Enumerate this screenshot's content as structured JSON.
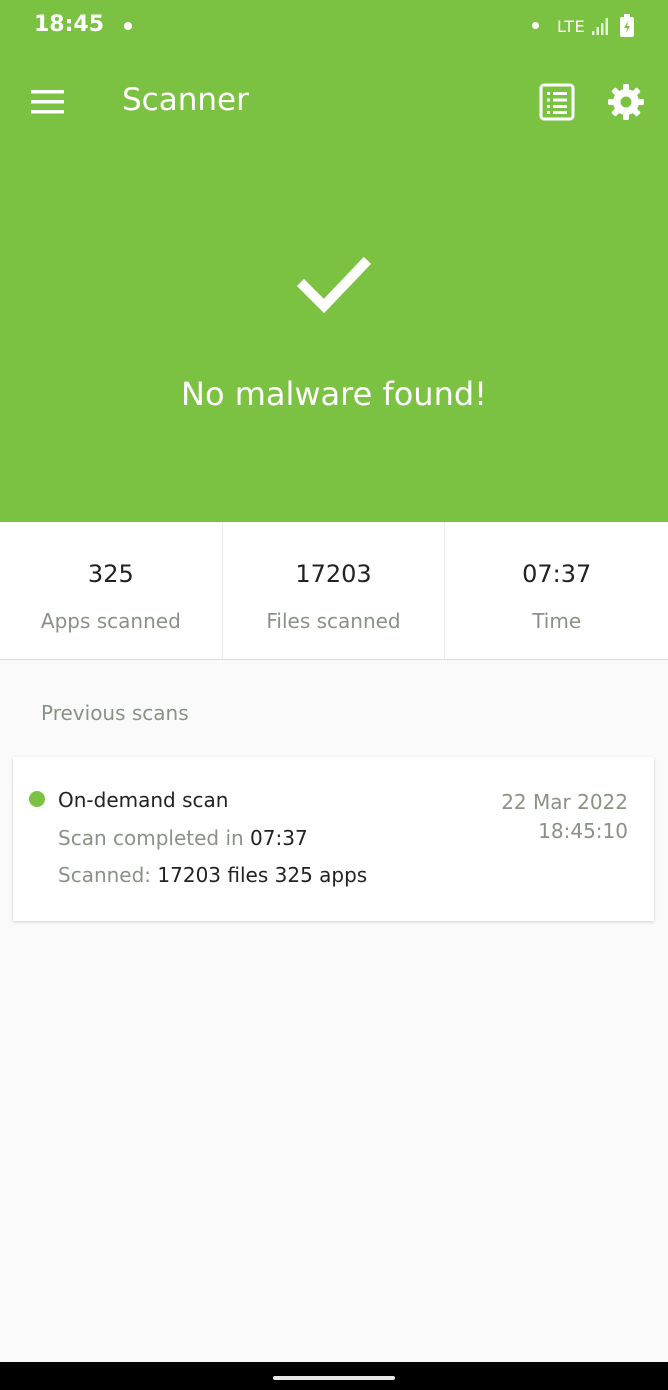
{
  "status_bar": {
    "time": "18:45",
    "network": "LTE"
  },
  "app_bar": {
    "title": "Scanner",
    "icons": [
      "menu-icon",
      "report-icon",
      "settings-icon"
    ]
  },
  "result": {
    "icon": "check-icon",
    "message": "No malware found!"
  },
  "stats": [
    {
      "value": "325",
      "label": "Apps scanned"
    },
    {
      "value": "17203",
      "label": "Files scanned"
    },
    {
      "value": "07:37",
      "label": "Time"
    }
  ],
  "previous": {
    "title": "Previous scans",
    "items": [
      {
        "name": "On-demand scan",
        "completed_label": "Scan completed in",
        "completed_value": "07:37",
        "scanned_label": "Scanned:",
        "scanned_value": "17203 files 325 apps",
        "date": "22 Mar 2022",
        "time": "18:45:10"
      }
    ]
  },
  "colors": {
    "brand": "#7cc242",
    "background": "#fafafa",
    "muted_text": "#8a9284",
    "primary_text": "#222222"
  }
}
